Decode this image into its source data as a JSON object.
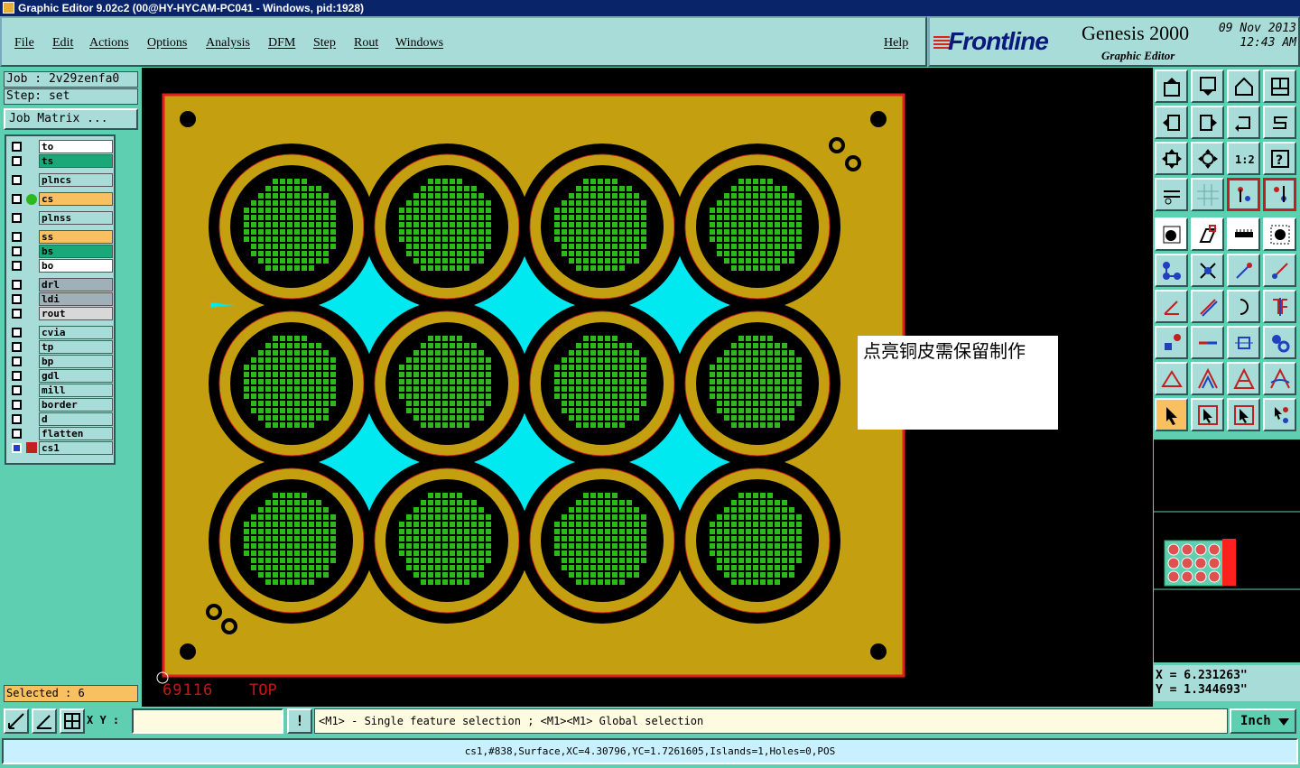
{
  "window": {
    "title": "Graphic Editor 9.02c2 (00@HY-HYCAM-PC041 - Windows, pid:1928)"
  },
  "menu": {
    "file": "File",
    "edit": "Edit",
    "actions": "Actions",
    "options": "Options",
    "analysis": "Analysis",
    "dfm": "DFM",
    "step": "Step",
    "rout": "Rout",
    "windows": "Windows",
    "help": "Help"
  },
  "brand": {
    "logo": "Frontline",
    "product": "Genesis 2000",
    "subtitle": "Graphic Editor",
    "date": "09 Nov 2013",
    "time": "12:43 AM"
  },
  "job": {
    "job_label": "Job : 2v29zenfa0",
    "step_label": "Step: set",
    "matrix_button": "Job Matrix ..."
  },
  "layers": [
    {
      "name": "to",
      "color": "#ffffff"
    },
    {
      "name": "ts",
      "color": "#1aa878"
    },
    {
      "name": "plncs",
      "color": "#a8dcd8"
    },
    {
      "name": "cs",
      "color": "#f8c060"
    },
    {
      "name": "plnss",
      "color": "#a8dcd8"
    },
    {
      "name": "ss",
      "color": "#f8c060"
    },
    {
      "name": "bs",
      "color": "#1aa878"
    },
    {
      "name": "bo",
      "color": "#ffffff"
    },
    {
      "name": "drl",
      "color": "#a0b0b8"
    },
    {
      "name": "ldi",
      "color": "#a0b0b8"
    },
    {
      "name": "rout",
      "color": "#d8d8d8"
    },
    {
      "name": "cvia",
      "color": "#a8dcd8"
    },
    {
      "name": "tp",
      "color": "#a8dcd8"
    },
    {
      "name": "bp",
      "color": "#a8dcd8"
    },
    {
      "name": "gdl",
      "color": "#a8dcd8"
    },
    {
      "name": "mill",
      "color": "#a8dcd8"
    },
    {
      "name": "border",
      "color": "#a8dcd8"
    },
    {
      "name": "d",
      "color": "#a8dcd8"
    },
    {
      "name": "flatten",
      "color": "#a8dcd8"
    },
    {
      "name": "cs1",
      "color": "#a8dcd8"
    }
  ],
  "selection": {
    "text": "Selected : 6"
  },
  "board": {
    "id_label": "69116",
    "side_label": "TOP"
  },
  "note": {
    "text": "点亮铜皮需保留制作"
  },
  "coords": {
    "x": "X  =  6.231263\"",
    "y": "Y  =  1.344693\""
  },
  "bottom": {
    "xy_label": "X Y :",
    "xy_value": "",
    "bang": "!",
    "hint": "<M1> - Single feature selection ; <M1><M1> Global selection",
    "units": "Inch"
  },
  "status": {
    "text": "cs1,#838,Surface,XC=4.30796,YC=1.7261605,Islands=1,Holes=0,POS"
  },
  "colors": {
    "copper": "#c4a010",
    "cyan": "#00e8f0",
    "green": "#2eb81e",
    "board_edge": "#e02020"
  }
}
